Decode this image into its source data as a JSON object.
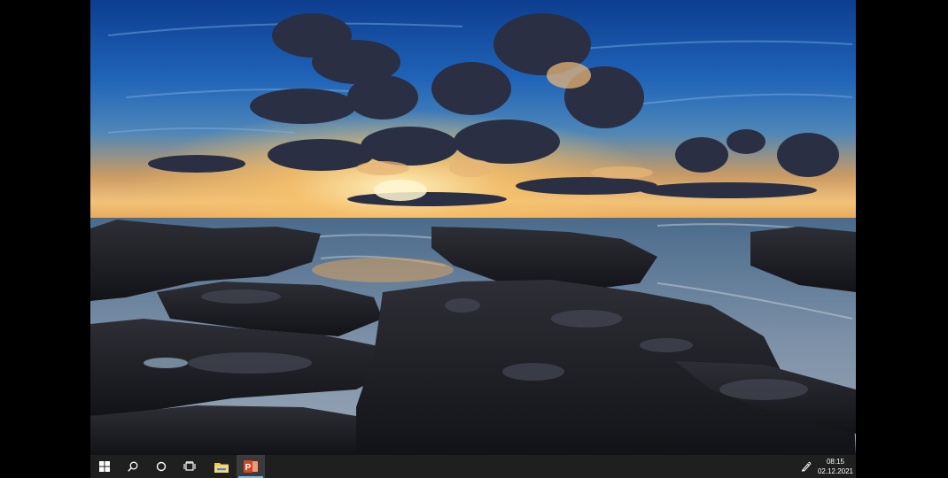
{
  "desktop": {
    "wallpaper": "coastal-sunset-rocks"
  },
  "taskbar": {
    "background": "#1f1f1f",
    "accent": "#76b9ed",
    "buttons": [
      {
        "id": "start",
        "icon": "windows-icon"
      },
      {
        "id": "search",
        "icon": "search-icon"
      },
      {
        "id": "cortana",
        "icon": "cortana-circle-icon"
      },
      {
        "id": "task-view",
        "icon": "task-view-icon"
      }
    ],
    "apps": [
      {
        "id": "file-explorer",
        "icon": "folder-icon",
        "active": false
      },
      {
        "id": "powerpoint",
        "icon": "powerpoint-icon",
        "active": true
      }
    ],
    "tray": {
      "icon": "pen-workspace-icon",
      "time": "08:15",
      "date": "02.12.2021"
    }
  }
}
